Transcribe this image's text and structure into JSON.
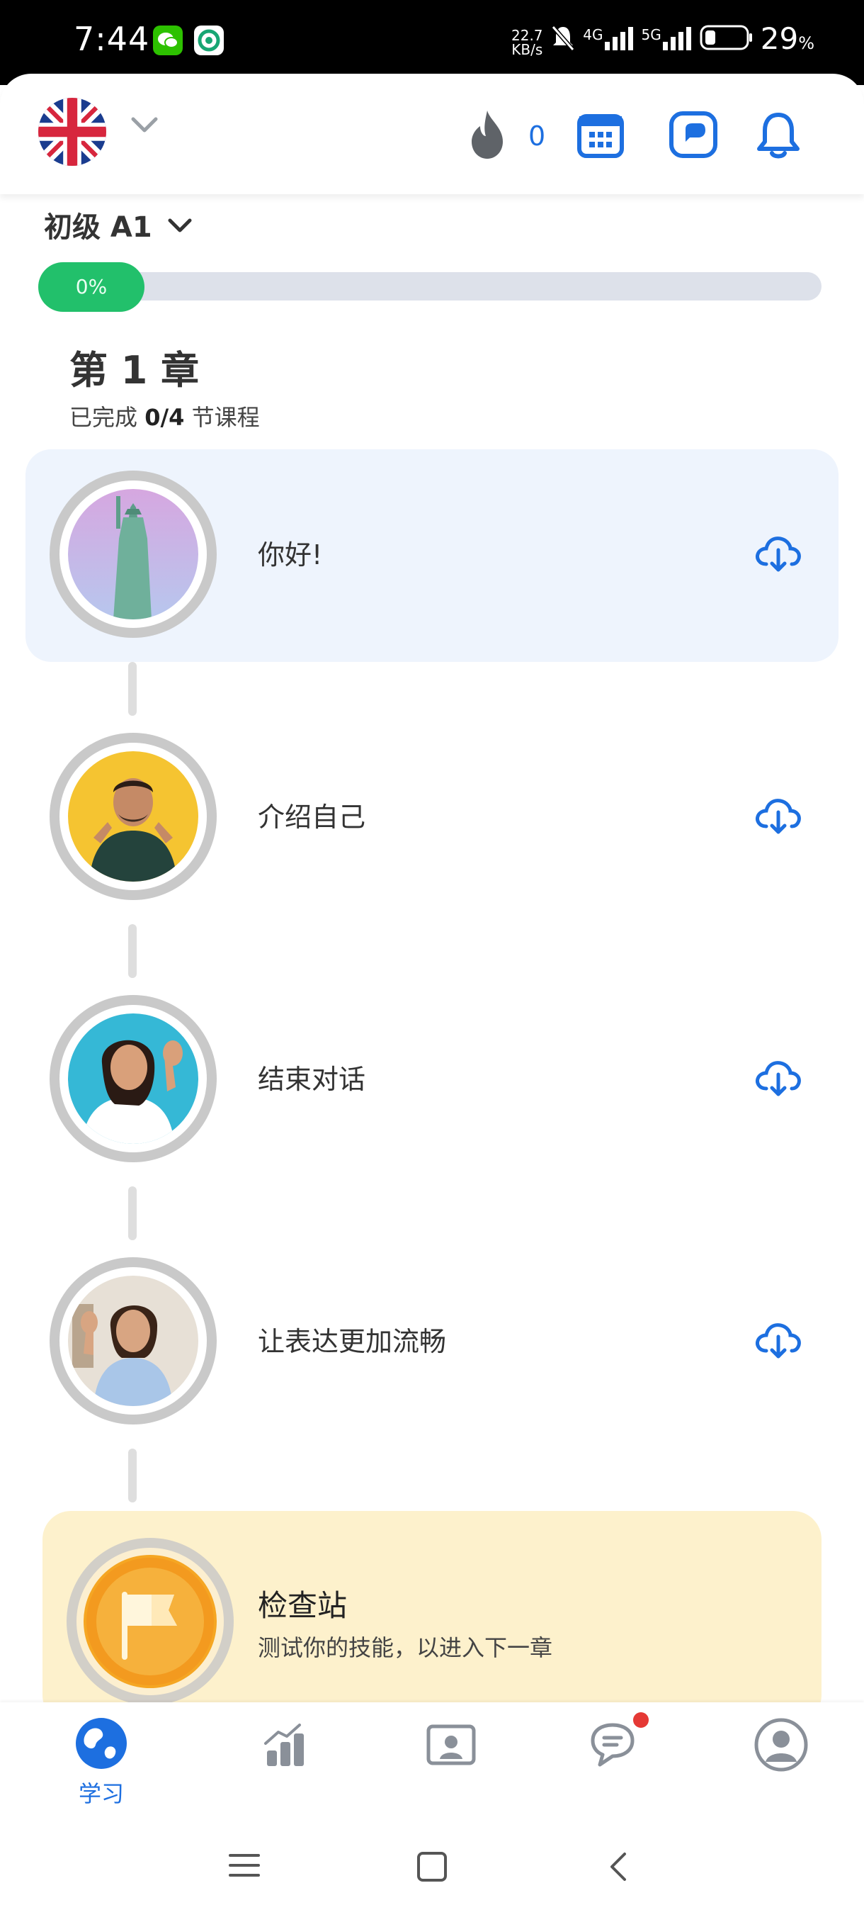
{
  "status_bar": {
    "time": "7:44",
    "net_speed_value": "22.7",
    "net_speed_unit": "KB/s",
    "signal1": "4G",
    "signal2": "5G",
    "battery_value": "29",
    "battery_unit": "%"
  },
  "header": {
    "language_flag": "uk-flag-icon",
    "streak_count": "0",
    "accent_color": "#1d6fe0"
  },
  "level": {
    "label": "初级 A1",
    "progress_text": "0%",
    "progress_value": 0
  },
  "chapter": {
    "title": "第 1 章",
    "completed_prefix": "已完成",
    "completed_count": "0/4",
    "completed_suffix": "节课程"
  },
  "lessons": [
    {
      "title": "你好!",
      "image": "statue-of-liberty"
    },
    {
      "title": "介绍自己",
      "image": "man-pointing"
    },
    {
      "title": "结束对话",
      "image": "woman-waving"
    },
    {
      "title": "让表达更加流畅",
      "image": "woman-waving-desk"
    }
  ],
  "checkpoint": {
    "title": "检查站",
    "subtitle": "测试你的技能，以进入下一章"
  },
  "bottom_nav": {
    "learn_label": "学习",
    "active_color": "#1d6fe0",
    "notification_color": "#e53935"
  }
}
